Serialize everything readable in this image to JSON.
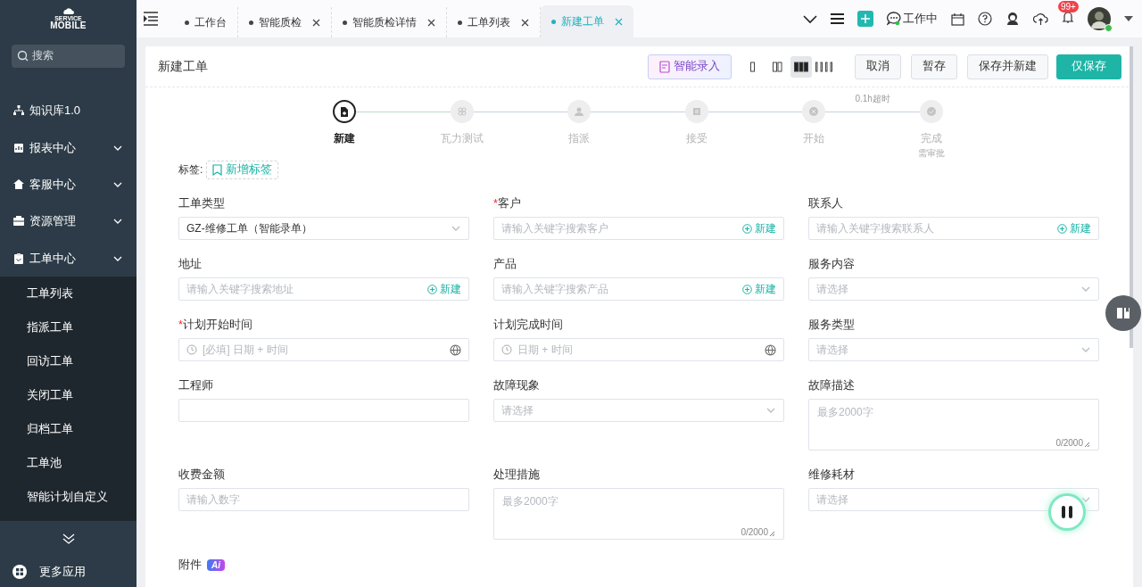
{
  "sidebar": {
    "logo": {
      "small": "SERVICE",
      "big": "MOBILE"
    },
    "search": {
      "placeholder": "搜索"
    },
    "items": [
      {
        "label": "知识库1.0",
        "kind": "link"
      },
      {
        "label": "报表中心",
        "kind": "group"
      },
      {
        "label": "客服中心",
        "kind": "group"
      },
      {
        "label": "资源管理",
        "kind": "group"
      },
      {
        "label": "工单中心",
        "kind": "group",
        "expanded": true,
        "children": [
          {
            "label": "工单列表"
          },
          {
            "label": "指派工单"
          },
          {
            "label": "回访工单"
          },
          {
            "label": "关闭工单"
          },
          {
            "label": "归档工单"
          },
          {
            "label": "工单池"
          },
          {
            "label": "智能计划自定义"
          }
        ]
      }
    ],
    "more": {
      "label": "更多应用"
    }
  },
  "tabs": [
    {
      "label": "工作台",
      "selected": false,
      "closable": false
    },
    {
      "label": "智能质检",
      "selected": false,
      "closable": true
    },
    {
      "label": "智能质检详情",
      "selected": false,
      "closable": true
    },
    {
      "label": "工单列表",
      "selected": false,
      "closable": true
    },
    {
      "label": "新建工单",
      "selected": true,
      "closable": true
    }
  ],
  "toolbar": {
    "status": "工作中",
    "badge": "99+"
  },
  "page": {
    "title": "新建工单",
    "ai_button": "智能录入",
    "layouts": [
      {
        "selected": false
      },
      {
        "selected": false
      },
      {
        "selected": true
      },
      {
        "selected": false
      }
    ],
    "buttons": [
      {
        "label": "取消",
        "kind": "default"
      },
      {
        "label": "暂存",
        "kind": "default"
      },
      {
        "label": "保存并新建",
        "kind": "default"
      },
      {
        "label": "仅保存",
        "kind": "primary"
      }
    ],
    "steps": [
      {
        "label": "新建",
        "active": true
      },
      {
        "label": "瓦力测试",
        "active": false
      },
      {
        "label": "指派",
        "active": false
      },
      {
        "label": "接受",
        "active": false
      },
      {
        "label": "开始",
        "active": false
      },
      {
        "label": "完成",
        "active": false,
        "note": "需审批",
        "timer": "0.1h超时"
      }
    ],
    "tags": {
      "label": "标签:",
      "add": "新增标签"
    },
    "fields": [
      {
        "kind": "select",
        "label": "工单类型",
        "value": "GZ-维修工单（智能录单）"
      },
      {
        "kind": "search",
        "label": "客户",
        "required_mark": "*",
        "placeholder": "请输入关键字搜索客户",
        "action": "新建"
      },
      {
        "kind": "search",
        "label": "联系人",
        "placeholder": "请输入关键字搜索联系人",
        "action": "新建"
      },
      {
        "kind": "search",
        "label": "地址",
        "placeholder": "请输入关键字搜索地址",
        "action": "新建"
      },
      {
        "kind": "search",
        "label": "产品",
        "placeholder": "请输入关键字搜索产品",
        "action": "新建"
      },
      {
        "kind": "select",
        "label": "服务内容",
        "placeholder": "请选择"
      },
      {
        "kind": "datetime",
        "label": "计划开始时间",
        "required_mark": "*",
        "placeholder": "[必填] 日期 + 时间"
      },
      {
        "kind": "datetime",
        "label": "计划完成时间",
        "placeholder": "日期 + 时间"
      },
      {
        "kind": "select",
        "label": "服务类型",
        "placeholder": "请选择"
      },
      {
        "kind": "text",
        "label": "工程师"
      },
      {
        "kind": "select",
        "label": "故障现象",
        "placeholder": "请选择"
      },
      {
        "kind": "textarea",
        "label": "故障描述",
        "placeholder": "最多2000字",
        "counter": "0/2000"
      },
      {
        "kind": "text",
        "label": "收费金额",
        "placeholder": "请输入数字"
      },
      {
        "kind": "textarea",
        "label": "处理措施",
        "placeholder": "最多2000字",
        "counter": "0/2000"
      },
      {
        "kind": "select",
        "label": "维修耗材",
        "placeholder": "请选择"
      }
    ],
    "attachments": {
      "label": "附件",
      "badge": "Ai"
    }
  }
}
